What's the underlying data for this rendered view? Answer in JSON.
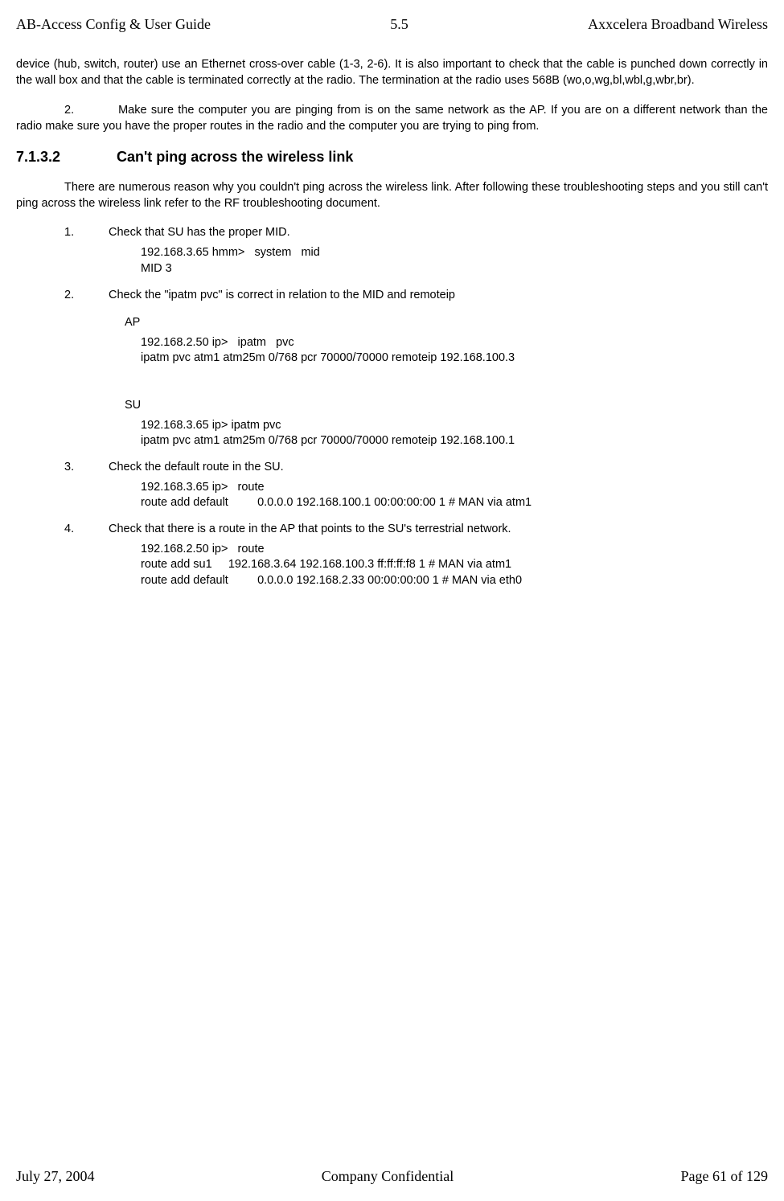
{
  "header": {
    "left": "AB-Access Config & User Guide",
    "center": "5.5",
    "right": "Axxcelera Broadband Wireless"
  },
  "paras": {
    "p1": "device (hub, switch, router) use an Ethernet cross-over cable (1-3, 2-6).  It is also important to check that the cable is punched down correctly in the wall box and that the cable is terminated correctly at the radio.  The termination at the radio uses 568B (wo,o,wg,bl,wbl,g,wbr,br).",
    "p2_num": "2.",
    "p2": "Make sure the computer you are pinging from is on the same network as the AP. If you are on a different network than the radio make sure you have the proper routes in the radio and the computer you are trying to ping from."
  },
  "section": {
    "num": "7.1.3.2",
    "title": "Can't ping across the wireless link",
    "intro": "There are numerous reason why you couldn't ping across the wireless link. After following these troubleshooting steps and you still can't ping across the wireless link refer to the RF troubleshooting document."
  },
  "steps": {
    "s1_num": "1.",
    "s1_txt": "Check that SU has the proper MID.",
    "s1_code": "192.168.3.65 hmm>   system   mid\nMID 3",
    "s2_num": "2.",
    "s2_txt": "Check the \"ipatm pvc\" is correct in relation to the MID and remoteip",
    "s2_ap_label": "AP",
    "s2_ap_code": "192.168.2.50 ip>   ipatm   pvc\nipatm pvc atm1 atm25m 0/768 pcr 70000/70000 remoteip 192.168.100.3",
    "s2_su_label": "SU",
    "s2_su_code": "192.168.3.65 ip> ipatm pvc\nipatm pvc atm1 atm25m 0/768 pcr 70000/70000 remoteip 192.168.100.1",
    "s3_num": "3.",
    "s3_txt": "Check the default route in the SU.",
    "s3_code": "192.168.3.65 ip>   route\nroute add default         0.0.0.0 192.168.100.1 00:00:00:00 1 # MAN via atm1",
    "s4_num": "4.",
    "s4_txt": "Check that there is a route in the AP that points to the SU's terrestrial network.",
    "s4_code": "192.168.2.50 ip>   route\nroute add su1     192.168.3.64 192.168.100.3 ff:ff:ff:f8 1 # MAN via atm1\nroute add default         0.0.0.0 192.168.2.33 00:00:00:00 1 # MAN via eth0"
  },
  "footer": {
    "left": "July 27, 2004",
    "center": "Company Confidential",
    "right": "Page 61 of 129"
  }
}
